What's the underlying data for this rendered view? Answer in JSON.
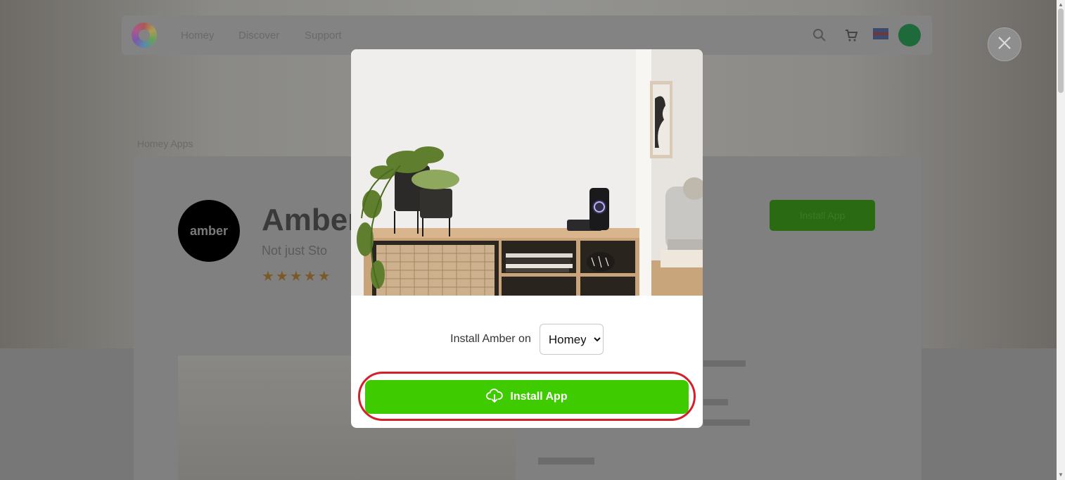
{
  "background_page": {
    "nav": {
      "links": [
        "Homey",
        "Discover",
        "Support"
      ]
    },
    "breadcrumb": "Homey Apps",
    "app": {
      "logo_text": "amber",
      "title": "Amber",
      "subtitle": "Not just Sto",
      "stars": "★★★★★",
      "install_label": "Install App"
    }
  },
  "modal": {
    "install_prefix": "Install Amber on",
    "platform": {
      "selected": "Homey",
      "options": [
        "Homey"
      ]
    },
    "install_button": "Install App"
  },
  "icons": {
    "close": "close-icon",
    "install": "cloud-download-icon"
  },
  "colors": {
    "install_green": "#3ecb00",
    "highlight_red": "#d3202a"
  }
}
